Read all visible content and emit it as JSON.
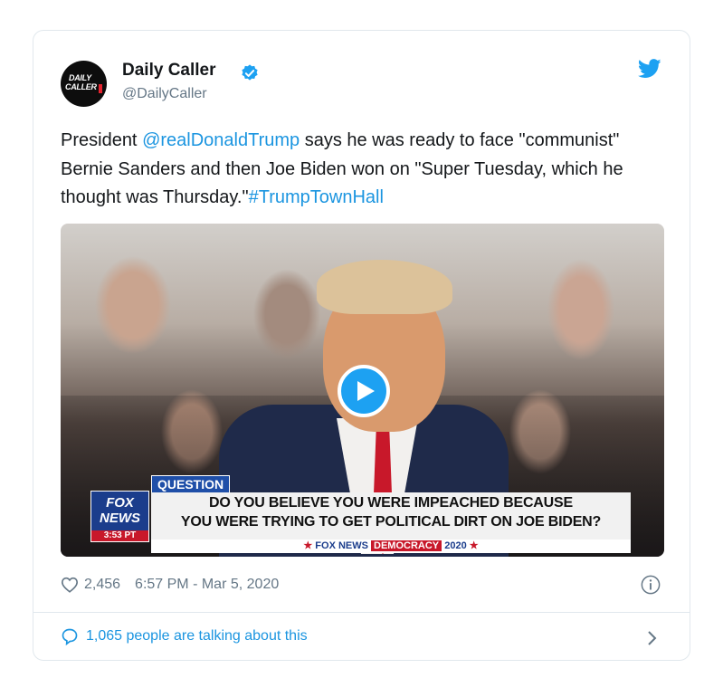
{
  "account": {
    "name": "Daily Caller",
    "handle": "@DailyCaller",
    "avatar_line1": "DAILY",
    "avatar_line2": "CALLER"
  },
  "tweet": {
    "text_1": "President ",
    "mention": "@realDonaldTrump",
    "text_2": " says he was ready to face \"communist\" Bernie Sanders and then Joe Biden won on \"Super Tuesday, which he thought was Thursday.\"",
    "hashtag": "#TrumpTownHall"
  },
  "media": {
    "question_tag": "QUESTION",
    "banner_line1": "DO YOU BELIEVE YOU WERE IMPEACHED BECAUSE",
    "banner_line2": "YOU WERE TRYING TO GET POLITICAL DIRT ON JOE BIDEN?",
    "logo_line1": "FOX",
    "logo_line2": "NEWS",
    "time": "3:53 PT",
    "strap_network": "FOX NEWS",
    "strap_democracy": "DEMOCRACY",
    "strap_year": "2020"
  },
  "meta": {
    "likes": "2,456",
    "time": "6:57 PM - Mar 5, 2020"
  },
  "footer": {
    "talking": "1,065 people are talking about this"
  },
  "colors": {
    "link": "#1b95e0",
    "twitter_blue": "#1da1f2",
    "muted": "#657786"
  },
  "icons": [
    "verified-icon",
    "twitter-bird-icon",
    "play-icon",
    "heart-icon",
    "info-icon",
    "comment-icon",
    "chevron-right-icon"
  ]
}
